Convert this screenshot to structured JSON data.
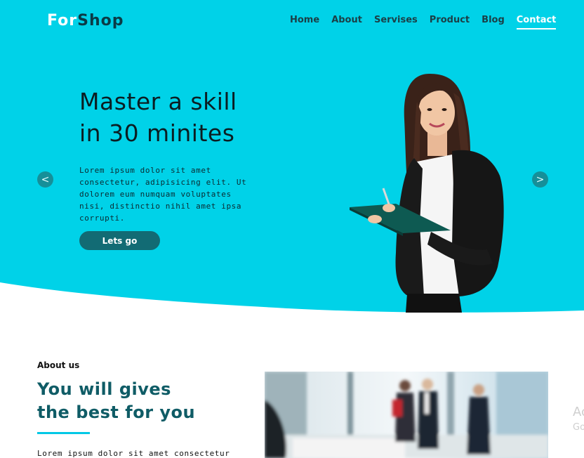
{
  "brand": {
    "part1": "For",
    "part2": "Shop"
  },
  "nav": {
    "items": [
      {
        "label": "Home"
      },
      {
        "label": "About"
      },
      {
        "label": "Servises"
      },
      {
        "label": "Product"
      },
      {
        "label": "Blog"
      },
      {
        "label": "Contact"
      }
    ],
    "active_index": 5
  },
  "hero": {
    "title_line1": "Master a skill",
    "title_line2": "in 30 minites",
    "body": "Lorem ipsum dolor sit amet consectetur, adipisicing elit. Ut dolorem eum numquam voluptates nisi, distinctio nihil amet ipsa corrupti.",
    "cta": "Lets go",
    "prev_arrow": "<",
    "next_arrow": ">"
  },
  "about": {
    "label": "About us",
    "title_line1": "You will gives",
    "title_line2": "the best for you",
    "body_start": "Lorem ipsum dolor sit amet consectetur"
  },
  "watermark": {
    "line1": "Ac",
    "line2": "Go"
  },
  "colors": {
    "hero_bg": "#00d2e8",
    "accent": "#126b74",
    "title_teal": "#0f5c66"
  }
}
